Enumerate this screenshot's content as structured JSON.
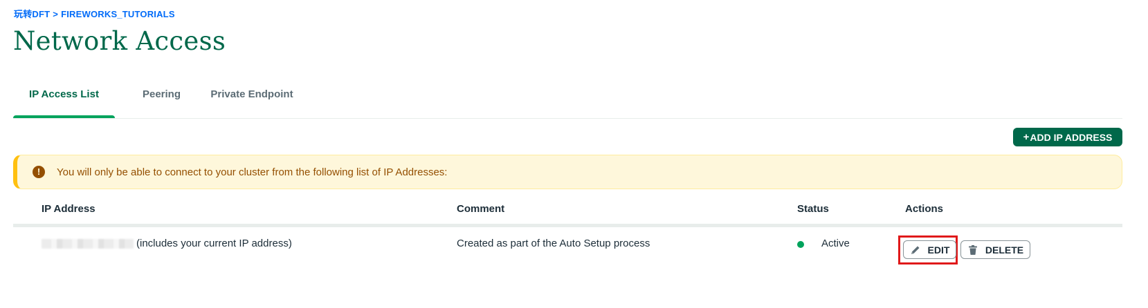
{
  "breadcrumb": {
    "org": "玩转DFT",
    "separator": ">",
    "project": "FIREWORKS_TUTORIALS"
  },
  "page": {
    "title": "Network Access"
  },
  "tabs": [
    {
      "label": "IP Access List",
      "active": true
    },
    {
      "label": "Peering",
      "active": false
    },
    {
      "label": "Private Endpoint",
      "active": false
    }
  ],
  "toolbar": {
    "add_ip_plus": "+",
    "add_ip_label": "ADD IP ADDRESS"
  },
  "banner": {
    "icon": "warning-icon",
    "icon_glyph": "!",
    "text": "You will only be able to connect to your cluster from the following list of IP Addresses:"
  },
  "table": {
    "columns": [
      "IP Address",
      "Comment",
      "Status",
      "Actions"
    ],
    "rows": [
      {
        "ip_note": "(includes your current IP address)",
        "comment": "Created as part of the Auto Setup process",
        "status": "Active",
        "status_color": "#00a35c",
        "actions": {
          "edit": "EDIT",
          "delete": "DELETE"
        }
      }
    ]
  },
  "colors": {
    "brand_green": "#00684a",
    "tab_underline": "#00a35c",
    "link_blue": "#016bf8",
    "warning_bg": "#fef7db",
    "warning_text": "#944f01",
    "highlight_red": "#e0191a"
  }
}
